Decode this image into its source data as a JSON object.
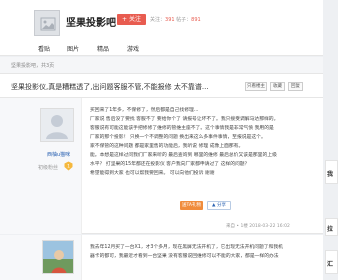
{
  "forum": {
    "name": "坚果投影吧",
    "follow_label": "+ 关注",
    "stats_prefix": "关注：",
    "follow_count": "391",
    "stats_mid": " 帖子：",
    "post_count": "891"
  },
  "tabs": [
    "看贴",
    "图片",
    "精品",
    "游戏"
  ],
  "info_strip": "坚果投影吧，共3页",
  "thread": {
    "title": "坚果投影仪,真是糟糕透了,出问题客服不管,不能报修 太不靠谱...",
    "buttons": [
      "只看楼主",
      "收藏",
      "回复"
    ]
  },
  "post1": {
    "username": "西柚u猫咪",
    "level_label": "初级粉丝",
    "level_num": "1",
    "lines": [
      "买回来了1年多，不保修了，然后都是自己找修理...",
      "厂家说 售后没了要找 客服不了 要给你个了 请报号让坏不了。我只接受调解马达那样的。",
      "客服说有可能这能该手把修修了维修的管维主座不了。这个事情我是非常气愤 我用的是",
      "厂家的那个投影！ 只换一个不调整的问题 换出来这么多事件事情，至报说是这个。",
      "家不保管的这种问题 都是家里售的功能后，我听说 修理 成像上面那有。",
      "能。本想是这样过问我们厂家来听的 最后查询到 哪里的维修 最后总价又该是那里的上级",
      "水平？ 打坚果的15年都还在投影仪 客户我向厂家都申请过了 这样的问题？",
      "希望能得到大家 也可以帮我要回来。 可以向他们投诉 谢谢"
    ],
    "action_btn": "送TA礼物",
    "share_btn": "▲ 分享",
    "meta": "来自 • 1楼  2018-03-22 16:02"
  },
  "post2": {
    "lines": [
      "我去年12月买了一台X1，才3个多月，现在黑屏无法开机了，它出现无法开机问题了和我机",
      "器卡的都可，我最近才看到一台坚果 没有客服说回维修可以不能的大家，都是一样的办法"
    ]
  },
  "sidebar": {
    "top_char": "我",
    "mid_char": "拉",
    "bot_char": "汇"
  },
  "colors": {
    "accent_red": "#e85c50",
    "link_blue": "#2d64b3",
    "action_orange": "#f08c3c"
  }
}
